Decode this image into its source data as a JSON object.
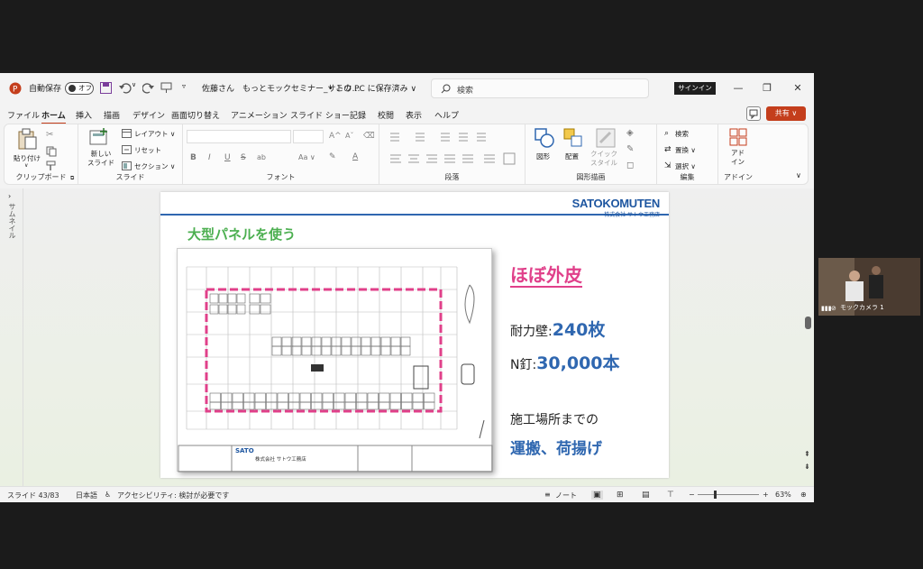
{
  "titlebar": {
    "autosave_label": "自動保存",
    "autosave_state": "オフ",
    "doc_title": "佐藤さん　もっとモックセミナー_サトウ…",
    "save_location": "• この PC に保存済み ∨",
    "search_placeholder": "検索",
    "signin_label": "サインイン"
  },
  "menu": {
    "items": [
      "ファイル",
      "ホーム",
      "挿入",
      "描画",
      "デザイン",
      "画面切り替え",
      "アニメーション",
      "スライド ショー",
      "記録",
      "校閲",
      "表示",
      "ヘルプ"
    ],
    "active": "ホーム",
    "share_label": "共有 ∨"
  },
  "ribbon": {
    "clipboard": {
      "paste": "貼り付け",
      "label": "クリップボード"
    },
    "slides": {
      "new_slide": "新しい\nスライド",
      "layout": "レイアウト ∨",
      "reset": "リセット",
      "section": "セクション ∨",
      "label": "スライド"
    },
    "font": {
      "label": "フォント",
      "bold": "B",
      "italic": "I",
      "underline": "U",
      "shadow": "S",
      "spacing": "ab",
      "case": "Aa ∨",
      "grow": "A^",
      "shrink": "Aˇ"
    },
    "paragraph": {
      "label": "段落"
    },
    "drawing": {
      "shapes": "図形",
      "arrange": "配置",
      "quick_styles": "クイック\nスタイル",
      "label": "図形描画"
    },
    "editing": {
      "find": "検索",
      "replace": "置換 ∨",
      "select": "選択 ∨",
      "label": "編集"
    },
    "addins": {
      "addin": "アド\nイン",
      "label": "アドイン"
    }
  },
  "thumbnails_label": "サムネイル",
  "slide": {
    "logo_main": "SATOKOMUTEN",
    "logo_sub": "株式会社 サトウ工務店",
    "heading": "大型パネルを使う",
    "big_label": "ほぼ外皮",
    "wall_label": "耐力壁:",
    "wall_value": "240枚",
    "nail_label": "N釘:",
    "nail_value": "30,000本",
    "transport_line1": "施工場所までの",
    "transport_line2": "運搬、荷揚げ",
    "plan_stamp": "SATO",
    "plan_company": "株式会社 サトウ工務店"
  },
  "status": {
    "slide_no": "スライド 43/83",
    "language": "日本語",
    "accessibility": "アクセシビリティ: 検討が必要です",
    "notes": "ノート",
    "zoom": "63%"
  },
  "camera": {
    "label": "モックカメラ 1"
  },
  "colors": {
    "accent": "#c43e1c",
    "magenta": "#e0408a",
    "slide_green": "#4caf50",
    "slide_blue": "#2f67b0"
  }
}
